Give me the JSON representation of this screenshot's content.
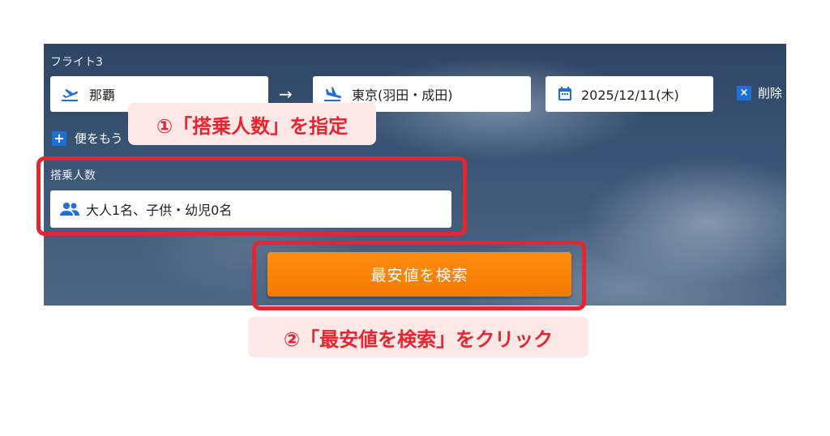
{
  "form": {
    "flight_label": "フライト3",
    "from_value": "那覇",
    "arrow": "→",
    "to_value": "東京(羽田・成田)",
    "date_value": "2025/12/11(木)",
    "delete_label": "削除",
    "delete_icon": "×",
    "add_flight_label": "便をもう",
    "add_icon": "+",
    "passengers_label": "搭乗人数",
    "passengers_value": "大人1名、子供・幼児0名",
    "search_button_label": "最安値を検索"
  },
  "annotations": {
    "step1": "①「搭乗人数」を指定",
    "step2": "②「最安値を検索」をクリック"
  },
  "colors": {
    "accent_blue": "#1e6fd9",
    "search_orange": "#f57a00",
    "highlight_red": "#e8252f",
    "callout_bg": "#fde8e8"
  },
  "icons": {
    "from": "airplane-departure-icon",
    "to": "airplane-arrival-icon",
    "date": "calendar-icon",
    "passengers": "people-icon",
    "delete": "close-icon",
    "add": "plus-icon"
  }
}
